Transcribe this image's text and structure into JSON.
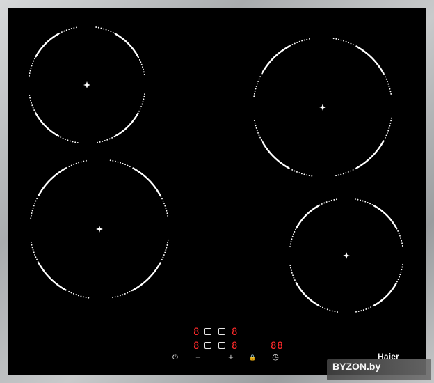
{
  "hob": {
    "brand": "Haier",
    "left_display": [
      "8",
      "8"
    ],
    "right_display": [
      "8",
      "8"
    ],
    "timer_display": "88",
    "controls": {
      "power_symbol": "⏻",
      "minus_symbol": "−",
      "plus_symbol": "+",
      "lock_symbol": "🔒",
      "timer_symbol": "◷"
    }
  },
  "watermark": "BYZON.by",
  "colors": {
    "glass": "#000000",
    "frame": "#b3b6b8",
    "zone_marks": "#ffffff",
    "display_digits": "#ff2a2a"
  }
}
